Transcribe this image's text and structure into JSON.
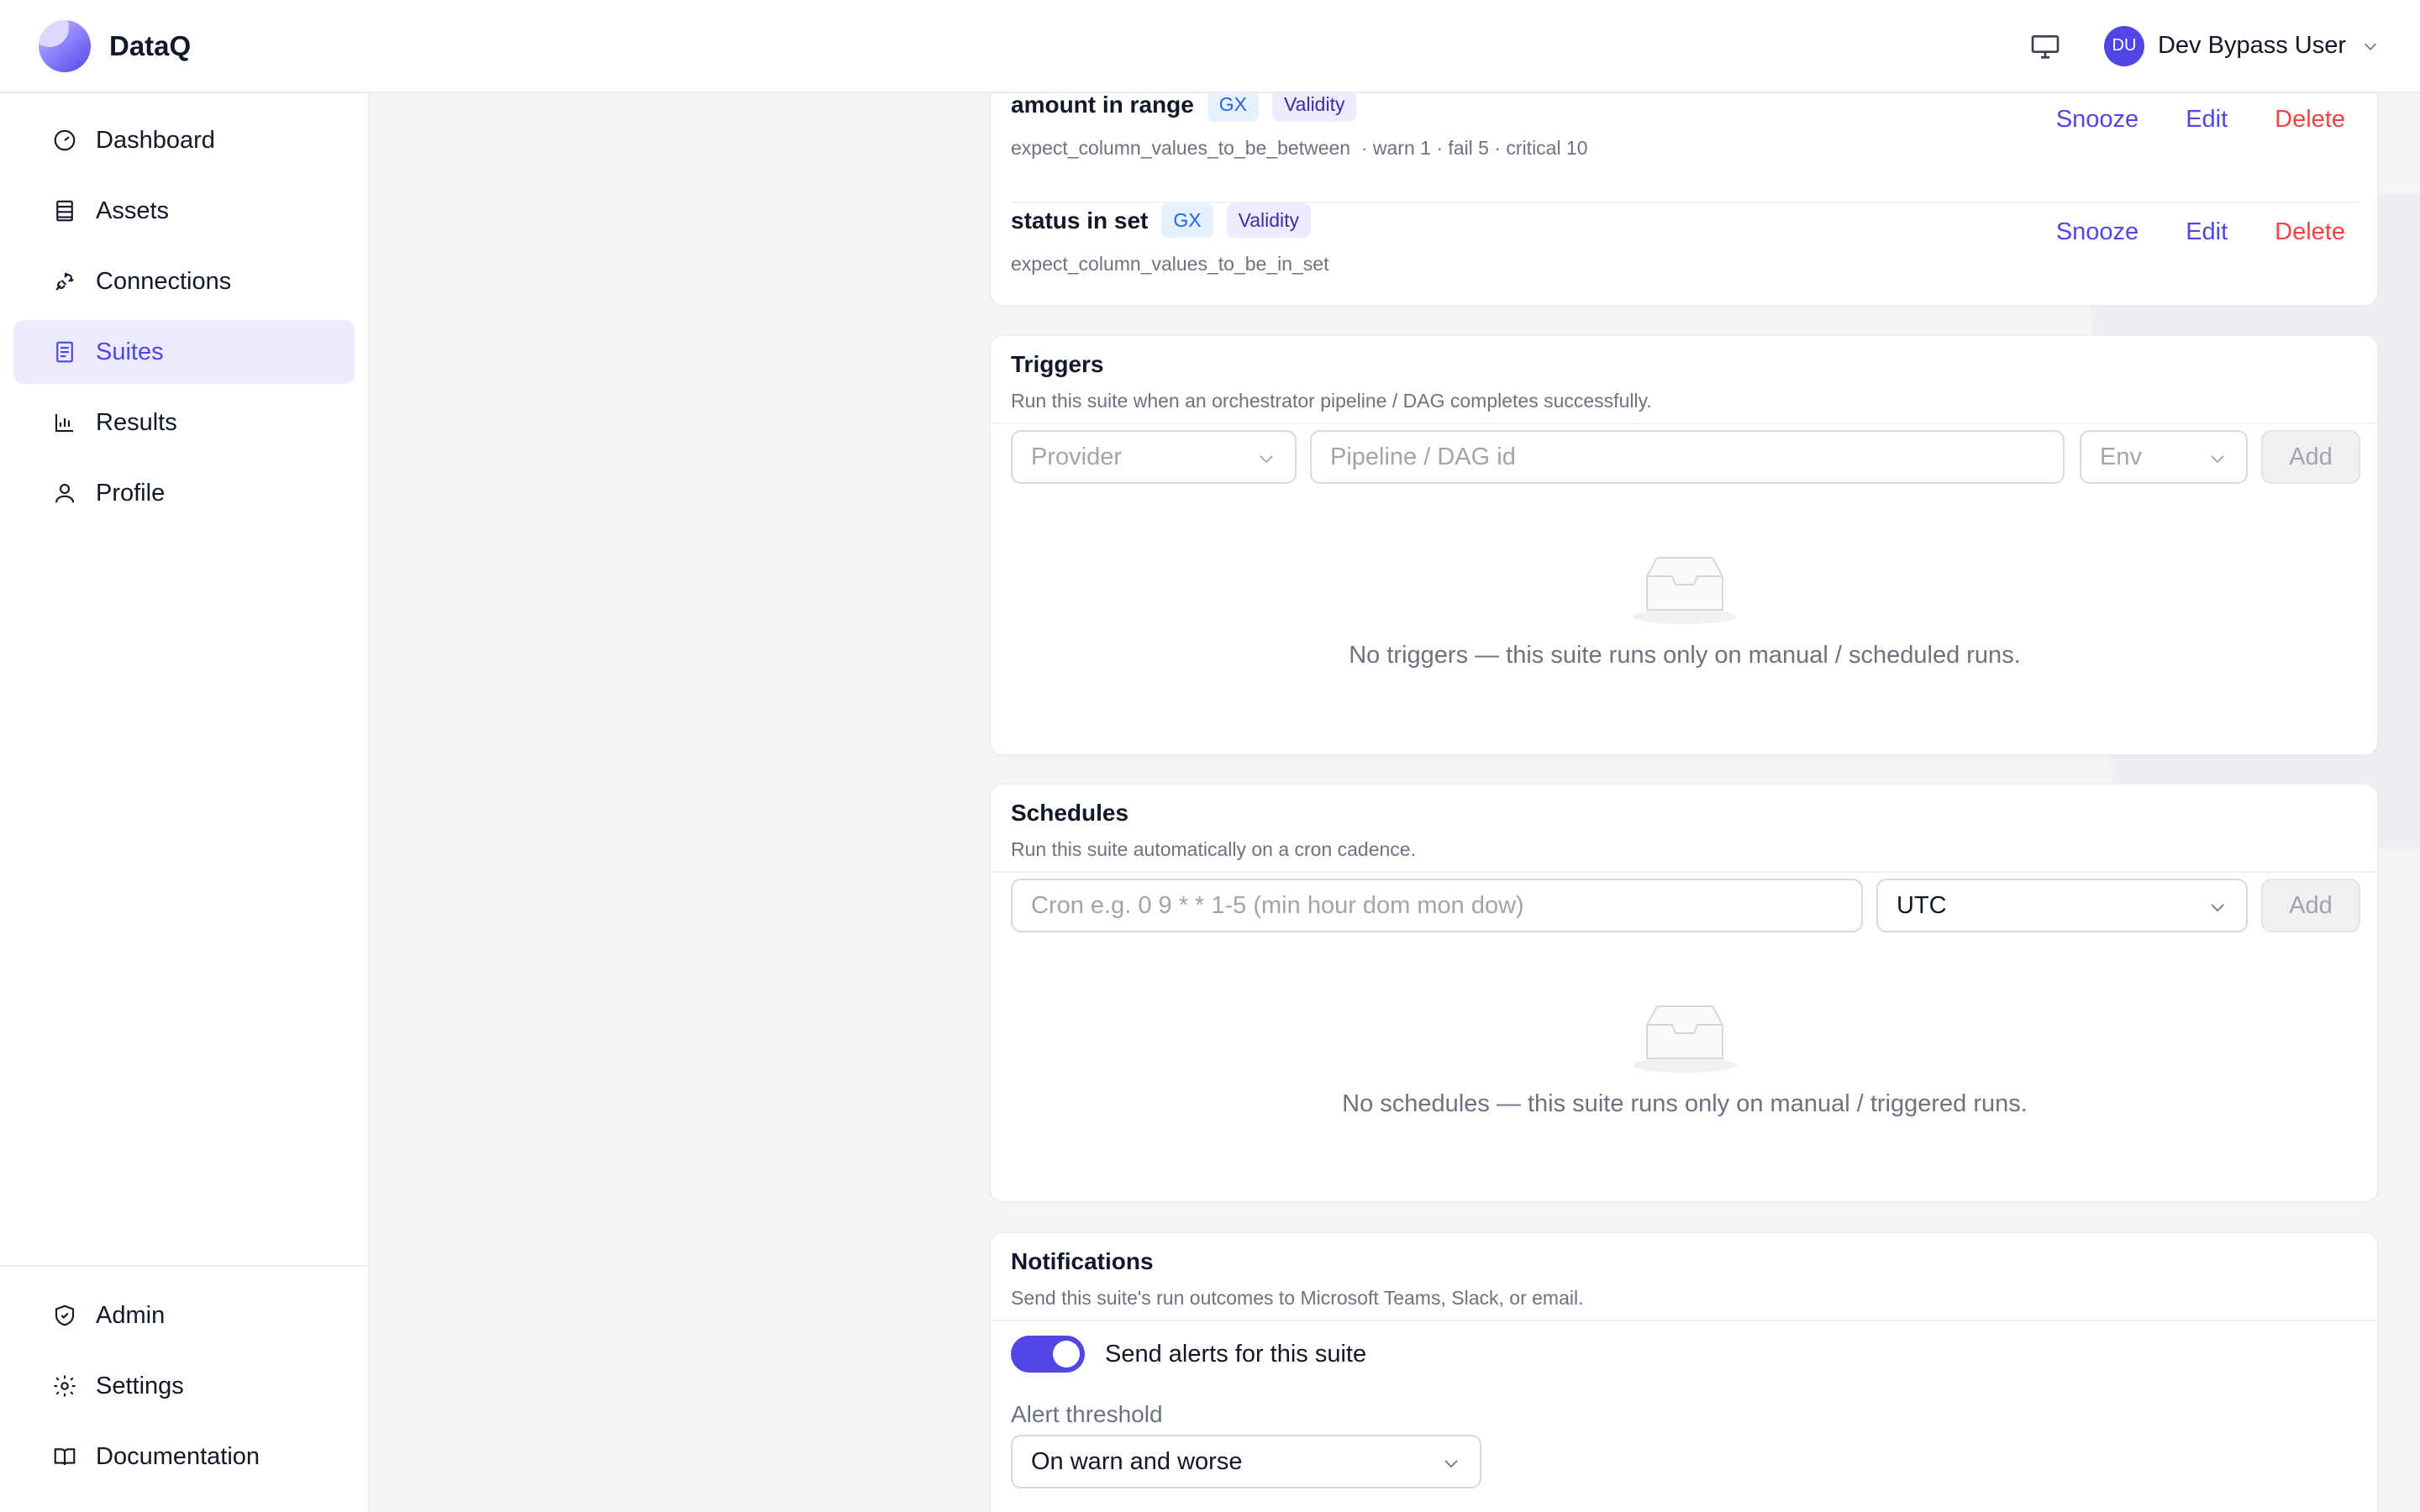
{
  "header": {
    "brand": "DataQ",
    "user_initials": "DU",
    "user_name": "Dev Bypass User"
  },
  "sidebar": {
    "items": [
      {
        "label": "Dashboard",
        "icon": "gauge-icon"
      },
      {
        "label": "Assets",
        "icon": "table-icon"
      },
      {
        "label": "Connections",
        "icon": "plug-icon"
      },
      {
        "label": "Suites",
        "icon": "document-icon",
        "active": true
      },
      {
        "label": "Results",
        "icon": "bar-chart-icon"
      },
      {
        "label": "Profile",
        "icon": "user-icon"
      }
    ],
    "bottom_items": [
      {
        "label": "Admin",
        "icon": "shield-icon"
      },
      {
        "label": "Settings",
        "icon": "gear-icon"
      },
      {
        "label": "Documentation",
        "icon": "book-icon"
      }
    ]
  },
  "rules": [
    {
      "title": "amount in range",
      "tags": [
        "GX",
        "Validity"
      ],
      "expectation": "expect_column_values_to_be_between",
      "thresholds": "· warn 1 · fail 5 · critical 10"
    },
    {
      "title": "status in set",
      "tags": [
        "GX",
        "Validity"
      ],
      "expectation": "expect_column_values_to_be_in_set",
      "thresholds": ""
    }
  ],
  "rule_actions": {
    "snooze": "Snooze",
    "edit": "Edit",
    "delete": "Delete"
  },
  "triggers": {
    "title": "Triggers",
    "description": "Run this suite when an orchestrator pipeline / DAG completes successfully.",
    "provider_placeholder": "Provider",
    "pipeline_placeholder": "Pipeline / DAG id",
    "env_placeholder": "Env",
    "add_label": "Add",
    "empty_text": "No triggers — this suite runs only on manual / scheduled runs."
  },
  "schedules": {
    "title": "Schedules",
    "description": "Run this suite automatically on a cron cadence.",
    "cron_placeholder": "Cron e.g. 0 9 * * 1-5 (min hour dom mon dow)",
    "timezone": "UTC",
    "add_label": "Add",
    "empty_text": "No schedules — this suite runs only on manual / triggered runs."
  },
  "notifications": {
    "title": "Notifications",
    "description": "Send this suite's run outcomes to Microsoft Teams, Slack, or email.",
    "toggle_label": "Send alerts for this suite",
    "toggle_on": true,
    "threshold_label": "Alert threshold",
    "threshold_value": "On warn and worse"
  }
}
